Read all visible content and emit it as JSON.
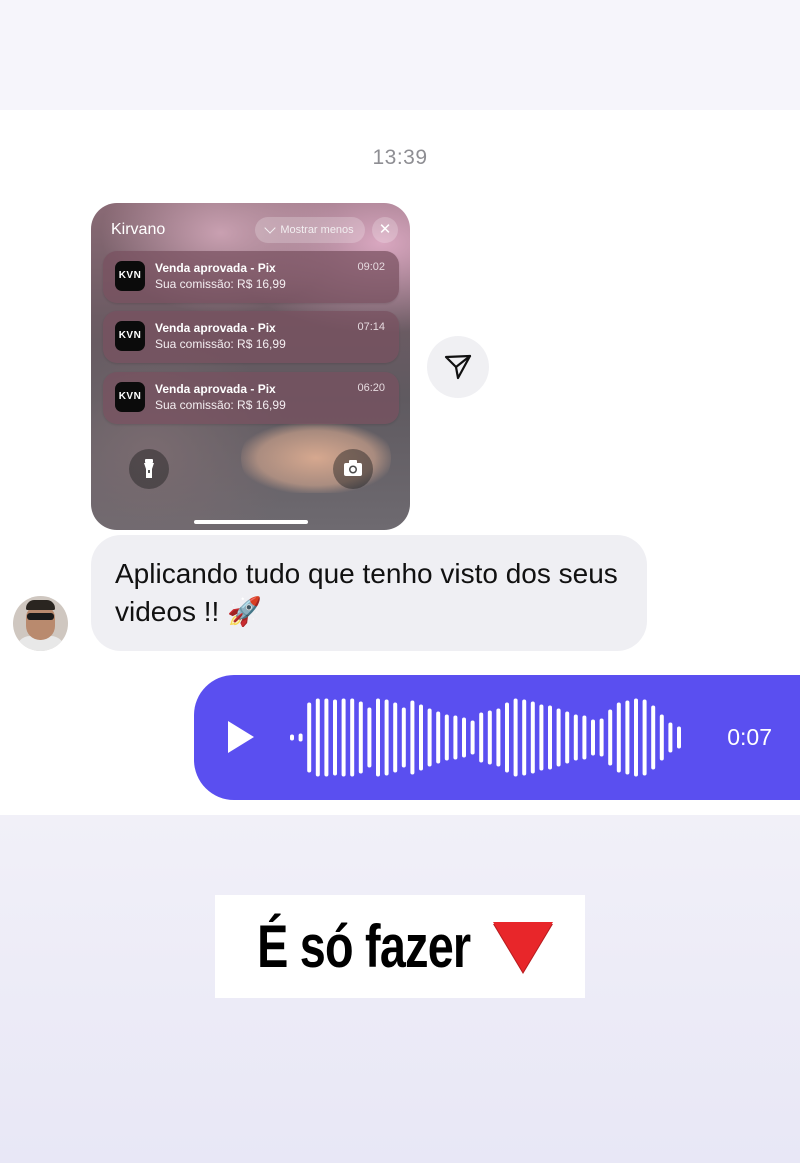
{
  "chat": {
    "timestamp": "13:39",
    "shared_screenshot": {
      "app_name": "Kirvano",
      "show_less_label": "Mostrar menos",
      "close_icon": "close-icon",
      "notifications": [
        {
          "icon_text": "KVN",
          "title": "Venda aprovada - Pix",
          "body": "Sua comissão: R$ 16,99",
          "time": "09:02"
        },
        {
          "icon_text": "KVN",
          "title": "Venda aprovada - Pix",
          "body": "Sua comissão: R$ 16,99",
          "time": "07:14"
        },
        {
          "icon_text": "KVN",
          "title": "Venda aprovada - Pix",
          "body": "Sua comissão: R$ 16,99",
          "time": "06:20"
        }
      ],
      "bottom_icons": [
        "flashlight-icon",
        "camera-icon"
      ]
    },
    "share_icon": "send-icon",
    "incoming_message": {
      "text": "Aplicando tudo que tenho visto dos seus videos !! 🚀"
    },
    "voice_message": {
      "duration": "0:07",
      "play_icon": "play-icon",
      "bubble_color": "#5a4ff0"
    }
  },
  "overlay": {
    "caption": "É só fazer",
    "caption_emoji": "red-triangle-down-icon",
    "accent_color": "#e8262a"
  }
}
